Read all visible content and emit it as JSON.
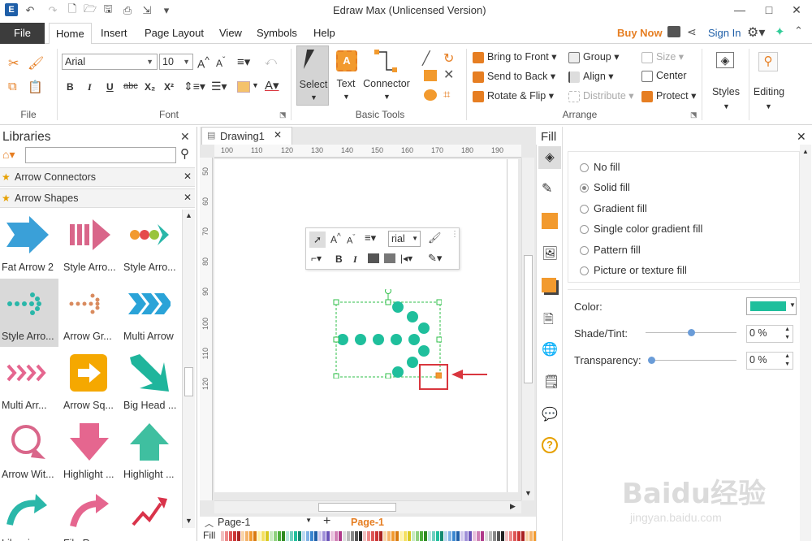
{
  "app": {
    "title": "Edraw Max (Unlicensed Version)"
  },
  "titlebar_right": {
    "buy_now": "Buy Now",
    "sign_in": "Sign In"
  },
  "menu": {
    "file": "File",
    "tabs": [
      "Home",
      "Insert",
      "Page Layout",
      "View",
      "Symbols",
      "Help"
    ]
  },
  "ribbon": {
    "groups": {
      "file": "File",
      "font": "Font",
      "basic_tools": "Basic Tools",
      "arrange": "Arrange"
    },
    "font_name": "Arial",
    "font_size": "10",
    "format_buttons": [
      "B",
      "I",
      "U",
      "abc",
      "X₂",
      "X²"
    ],
    "basic_tools": {
      "select": "Select",
      "text": "Text",
      "connector": "Connector"
    },
    "arrange": {
      "bring_to_front": "Bring to Front",
      "send_to_back": "Send to Back",
      "rotate_flip": "Rotate & Flip",
      "group": "Group",
      "align": "Align",
      "distribute": "Distribute",
      "size": "Size",
      "center": "Center",
      "protect": "Protect"
    },
    "styles": "Styles",
    "editing": "Editing"
  },
  "libraries": {
    "title": "Libraries",
    "search_placeholder": "",
    "categories": [
      "Arrow Connectors",
      "Arrow Shapes"
    ],
    "shapes": [
      {
        "label": "Fat Arrow 2",
        "color": "#3aa0d8"
      },
      {
        "label": "Style Arro...",
        "color": "#d9668a"
      },
      {
        "label": "Style Arro...",
        "color": "#f29a2e"
      },
      {
        "label": "Style Arro...",
        "color": "#2ab7a9"
      },
      {
        "label": "Arrow Gr...",
        "color": "#d98b5f"
      },
      {
        "label": "Multi Arrow",
        "color": "#2aa3d8"
      },
      {
        "label": "Multi Arr...",
        "color": "#e5668f"
      },
      {
        "label": "Arrow Sq...",
        "color": "#f5a800"
      },
      {
        "label": "Big Head ...",
        "color": "#1fb59c"
      },
      {
        "label": "Arrow Wit...",
        "color": "#d9668a"
      },
      {
        "label": "Highlight ...",
        "color": "#e5668f"
      },
      {
        "label": "Highlight ...",
        "color": "#3fbfa0"
      },
      {
        "label": "Libraries",
        "color": "#2ab7a9"
      },
      {
        "label": "File Recovery",
        "color": "#e5668f"
      },
      {
        "label": "",
        "color": "#d9334a"
      }
    ]
  },
  "document": {
    "tab": "Drawing1"
  },
  "ruler": {
    "h": [
      "100",
      "110",
      "120",
      "130",
      "140",
      "150",
      "160",
      "170",
      "180",
      "190"
    ],
    "v": [
      "50",
      "60",
      "70",
      "80",
      "90",
      "100",
      "110",
      "120"
    ]
  },
  "mini_toolbar": {
    "font": "rial"
  },
  "pages": {
    "current": "Page-1",
    "tab": "Page-1"
  },
  "fill_bar": {
    "label": "Fill"
  },
  "fill_panel": {
    "title": "Fill",
    "options": [
      "No fill",
      "Solid fill",
      "Gradient fill",
      "Single color gradient fill",
      "Pattern fill",
      "Picture or texture fill"
    ],
    "selected": "Solid fill",
    "color_label": "Color:",
    "color_value": "#1fbf9c",
    "shade_label": "Shade/Tint:",
    "shade_value": "0 %",
    "transparency_label": "Transparency:",
    "transparency_value": "0 %"
  },
  "watermark": {
    "main": "Baidu经验",
    "sub": "jingyan.baidu.com"
  },
  "colors": {
    "accent": "#e67e22",
    "selection_green": "#2fbf4a",
    "shape_teal": "#1fbf9c",
    "annotation_red": "#d9363e"
  }
}
